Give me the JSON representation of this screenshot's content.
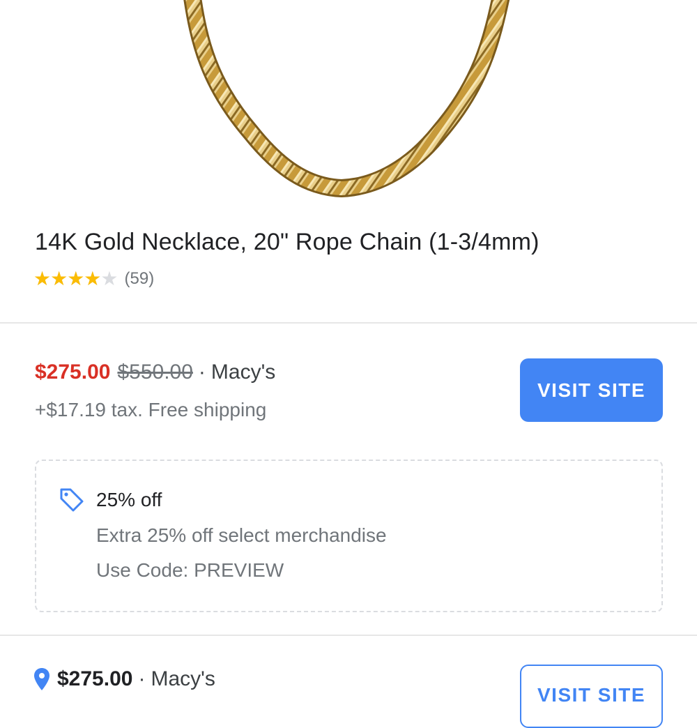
{
  "product": {
    "image_alt": "gold rope chain necklace",
    "title": "14K Gold Necklace, 20\" Rope Chain (1-3/4mm)",
    "rating": 4.0,
    "rating_max": 5,
    "stars_glyph": "★★★★★",
    "review_count": "(59)"
  },
  "offer": {
    "sale_price": "$275.00",
    "original_price": "$550.00",
    "separator": "·",
    "seller": "Macy's",
    "tax_shipping": "+$17.19 tax. Free shipping",
    "button_label": "VISIT SITE"
  },
  "promo": {
    "icon": "tag-icon",
    "title": "25% off",
    "description": "Extra 25% off select merchandise",
    "code_line": "Use Code: PREVIEW"
  },
  "store_offer": {
    "icon": "location-pin-icon",
    "price": "$275.00",
    "separator": "·",
    "seller": "Macy's",
    "button_label": "VISIT SITE"
  },
  "colors": {
    "accent": "#4285f4",
    "sale_price": "#d93025",
    "star": "#fbbc04",
    "secondary_text": "#70757a",
    "gold": "#d9b45a"
  }
}
